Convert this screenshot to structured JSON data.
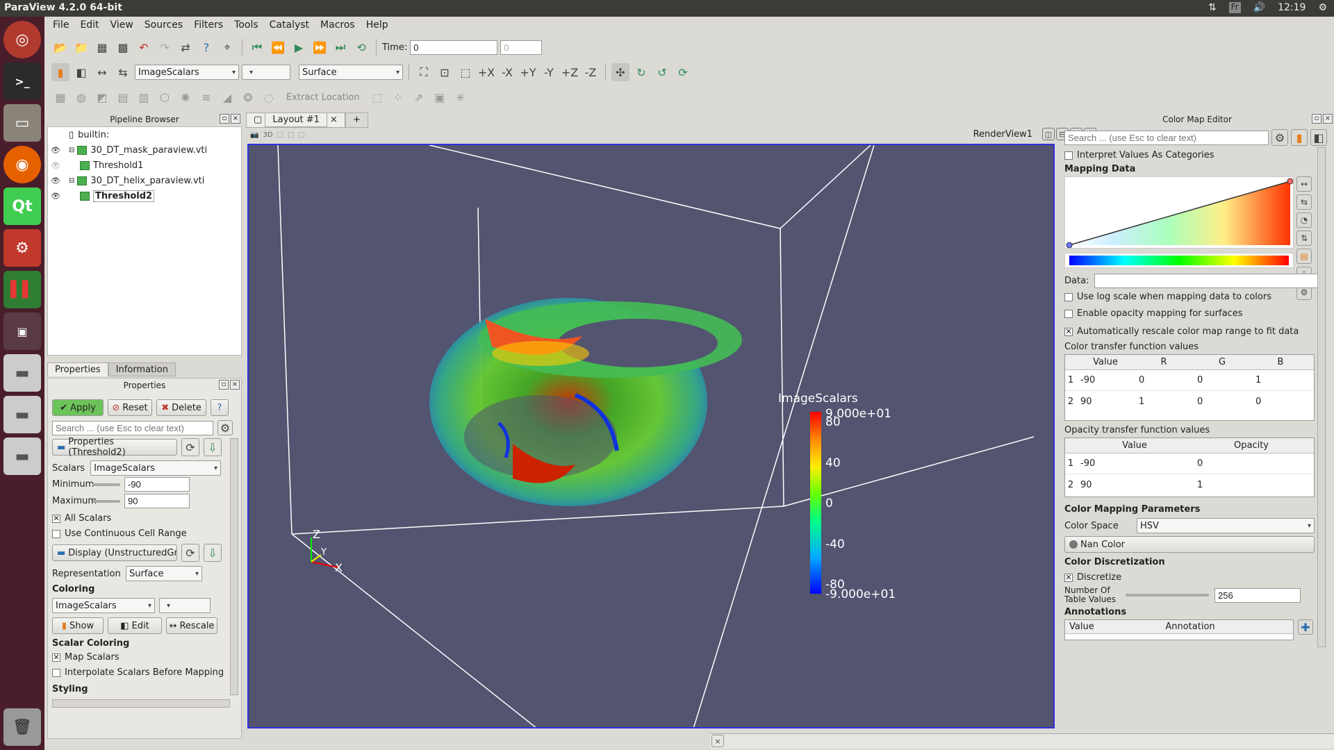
{
  "os": {
    "title": "ParaView 4.2.0 64-bit",
    "lang": "Fr",
    "clock": "12:19"
  },
  "launcher": [
    "ubuntu-logo-icon",
    "terminal-icon",
    "files-icon",
    "firefox-icon",
    "qt-icon",
    "settings-icon",
    "paraview-icon",
    "window-icon",
    "drive-icon",
    "drive-icon",
    "drive-icon",
    "trash-icon"
  ],
  "menu": [
    "File",
    "Edit",
    "View",
    "Sources",
    "Filters",
    "Tools",
    "Catalyst",
    "Macros",
    "Help"
  ],
  "toolbar": {
    "time_label": "Time:",
    "time_value": "0",
    "time_index": "0",
    "color_by": "ImageScalars",
    "representation": "Surface",
    "extract_location": "Extract Location"
  },
  "pipeline": {
    "title": "Pipeline Browser",
    "root": "builtin:",
    "items": [
      "30_DT_mask_paraview.vti",
      "Threshold1",
      "30_DT_helix_paraview.vti",
      "Threshold2"
    ]
  },
  "tabs": {
    "properties": "Properties",
    "information": "Information"
  },
  "props": {
    "title": "Properties",
    "apply": "Apply",
    "reset": "Reset",
    "delete": "Delete",
    "help": "?",
    "search_placeholder": "Search ... (use Esc to clear text)",
    "section_props": "Properties (Threshold2)",
    "scalars_label": "Scalars",
    "scalars_value": "ImageScalars",
    "min_label": "Minimum",
    "min_value": "-90",
    "max_label": "Maximum",
    "max_value": "90",
    "all_scalars": "All Scalars",
    "continuous": "Use Continuous Cell Range",
    "section_display": "Display (UnstructuredGrid)",
    "repr_label": "Representation",
    "repr_value": "Surface",
    "coloring": "Coloring",
    "color_value": "ImageScalars",
    "show": "Show",
    "edit": "Edit",
    "rescale": "Rescale",
    "scalar_coloring": "Scalar Coloring",
    "map_scalars": "Map Scalars",
    "interpolate": "Interpolate Scalars Before Mapping",
    "styling": "Styling"
  },
  "layout": {
    "tab": "Layout #1",
    "plus": "+",
    "view_name": "RenderView1",
    "view_3d": "3D"
  },
  "scalar_bar": {
    "title": "ImageScalars",
    "labels": [
      "9.000e+01",
      "80",
      "40",
      "0",
      "-40",
      "-80",
      "-9.000e+01"
    ]
  },
  "axes": {
    "z": "Z",
    "y": "Y",
    "x": "X"
  },
  "cme": {
    "title": "Color Map Editor",
    "search_placeholder": "Search ... (use Esc to clear text)",
    "interpret": "Interpret Values As Categories",
    "mapping_data": "Mapping Data",
    "data_label": "Data:",
    "log_scale": "Use log scale when mapping data to colors",
    "opacity_mapping": "Enable opacity mapping for surfaces",
    "auto_rescale": "Automatically rescale color map range to fit data",
    "ctf_title": "Color transfer function values",
    "ctf_headers": [
      "Value",
      "R",
      "G",
      "B"
    ],
    "ctf_rows": [
      [
        "1",
        "-90",
        "0",
        "0",
        "1"
      ],
      [
        "2",
        "90",
        "1",
        "0",
        "0"
      ]
    ],
    "otf_title": "Opacity transfer function values",
    "otf_headers": [
      "Value",
      "Opacity"
    ],
    "otf_rows": [
      [
        "1",
        "-90",
        "0"
      ],
      [
        "2",
        "90",
        "1"
      ]
    ],
    "cmp_title": "Color Mapping Parameters",
    "color_space_label": "Color Space",
    "color_space": "HSV",
    "nan_color": "Nan Color",
    "discretization": "Color Discretization",
    "discretize": "Discretize",
    "table_values_label": "Number Of Table Values",
    "table_values": "256",
    "annotations": "Annotations",
    "ann_headers": [
      "Value",
      "Annotation"
    ]
  },
  "colors": {
    "launcher": "#4a1d2a",
    "view_bg": "#525470",
    "view_border": "#3030e0",
    "apply": "#6cc35a"
  }
}
